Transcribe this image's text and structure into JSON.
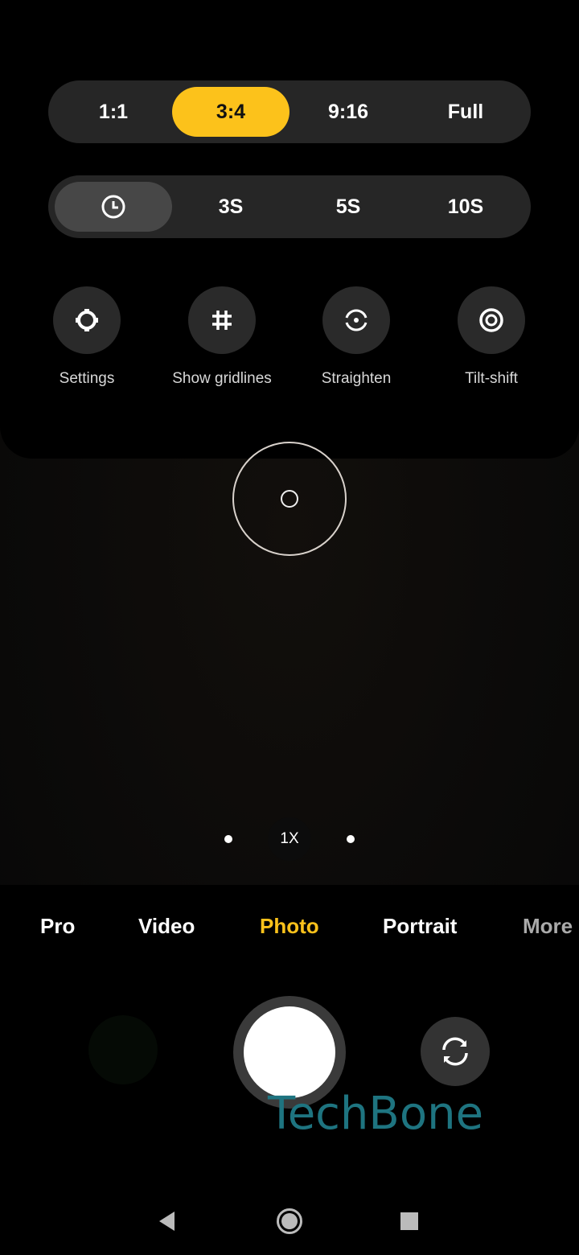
{
  "aspect_ratio": {
    "options": [
      "1:1",
      "3:4",
      "9:16",
      "Full"
    ],
    "selected": "3:4"
  },
  "timer": {
    "options": [
      "timer-off-icon",
      "3S",
      "5S",
      "10S"
    ],
    "labels": {
      "s3": "3S",
      "s5": "5S",
      "s10": "10S"
    },
    "selected": "off"
  },
  "tools": [
    {
      "label": "Settings",
      "icon": "gear-icon"
    },
    {
      "label": "Show gridlines",
      "icon": "grid-icon"
    },
    {
      "label": "Straighten",
      "icon": "level-icon"
    },
    {
      "label": "Tilt-shift",
      "icon": "tilt-shift-icon"
    }
  ],
  "zoom": {
    "level": "1X"
  },
  "modes": {
    "items": [
      "Pro",
      "Video",
      "Photo",
      "Portrait",
      "More"
    ],
    "selected": "Photo"
  },
  "watermark": "TechBone",
  "colors": {
    "accent": "#fcc21b",
    "panel": "#262626",
    "watermark": "#1e7480"
  }
}
